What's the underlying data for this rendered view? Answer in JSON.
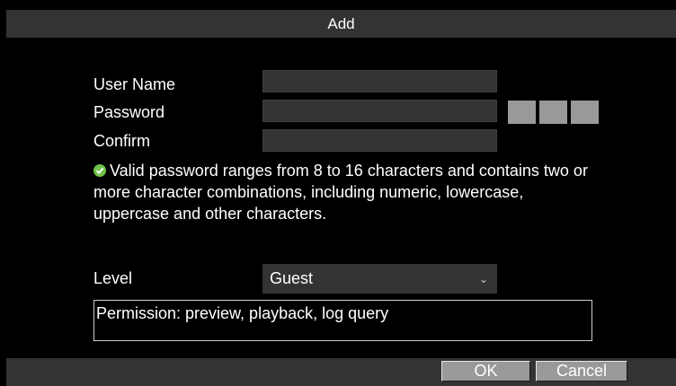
{
  "dialog": {
    "title": "Add"
  },
  "form": {
    "user_name_label": "User Name",
    "user_name_value": "",
    "password_label": "Password",
    "password_value": "",
    "confirm_label": "Confirm",
    "confirm_value": "",
    "password_hint": "Valid password ranges from 8 to 16 characters and contains two or more character combinations, including numeric, lowercase, uppercase and other characters.",
    "password_strength_segments": 3,
    "level_label": "Level",
    "level_value": "Guest",
    "permission_text": "Permission: preview, playback, log query"
  },
  "buttons": {
    "ok": "OK",
    "cancel": "Cancel"
  },
  "icons": {
    "hint": "check-circle-icon",
    "dropdown": "chevron-down-icon"
  },
  "colors": {
    "background": "#000000",
    "titlebar": "#333333",
    "field": "#333333",
    "strength_segment": "#999999",
    "hint_icon": "#71c34b",
    "button": "#999999",
    "text": "#ffffff"
  }
}
